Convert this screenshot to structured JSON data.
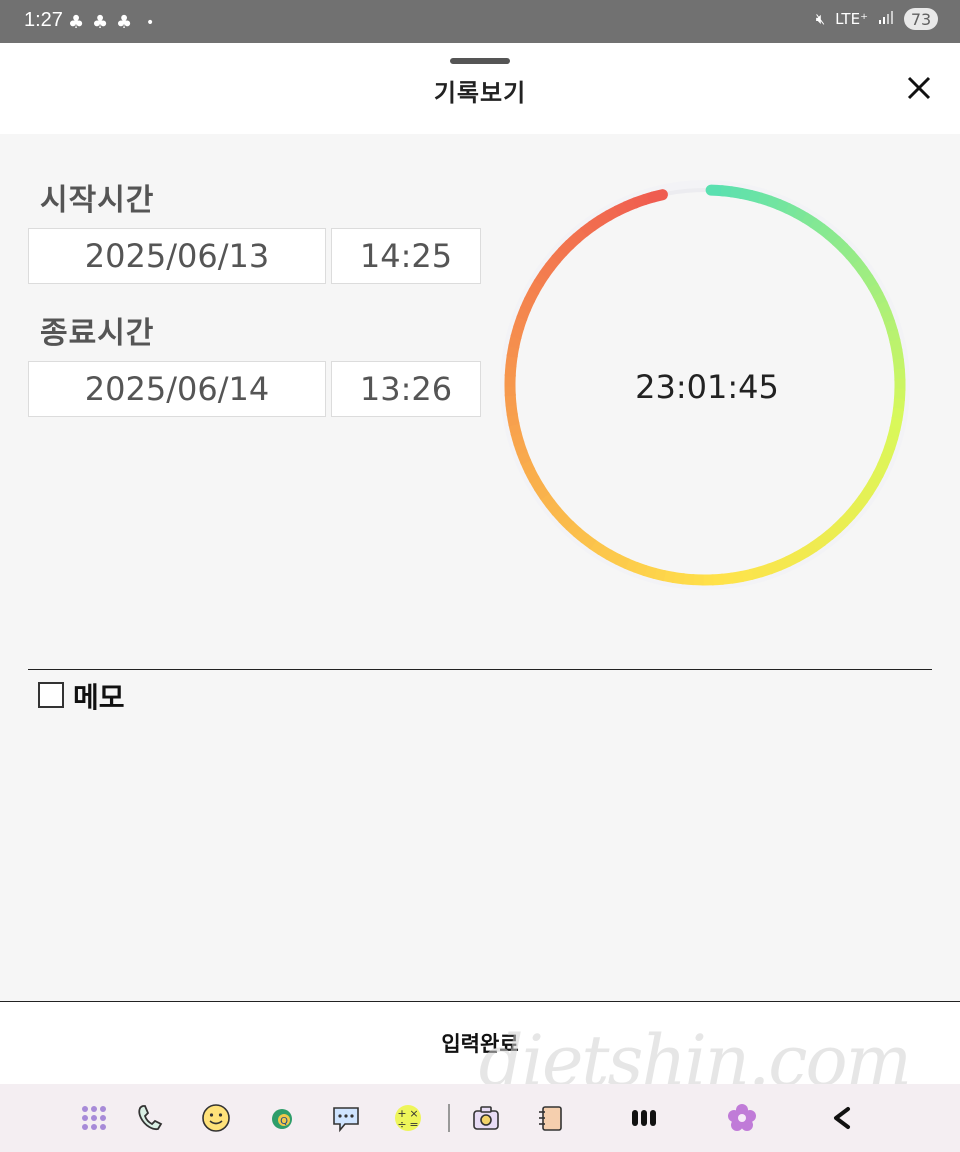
{
  "status_bar": {
    "time": "1:27",
    "battery": "73",
    "network": "LTE⁺"
  },
  "header": {
    "title": "기록보기"
  },
  "start": {
    "label": "시작시간",
    "date": "2025/06/13",
    "time": "14:25"
  },
  "end": {
    "label": "종료시간",
    "date": "2025/06/14",
    "time": "13:26"
  },
  "duration": {
    "text": "23:01:45",
    "fraction": 0.96
  },
  "memo": {
    "label": "메모",
    "checked": false
  },
  "submit": {
    "label": "입력완료"
  },
  "watermark": "dietshin.com",
  "colors": {
    "ring_start": "#5ae0b0",
    "ring_mid_right": "#d8f85a",
    "ring_bottom": "#ffe24a",
    "ring_end": "#ef5a50",
    "track": "#ececf0"
  }
}
